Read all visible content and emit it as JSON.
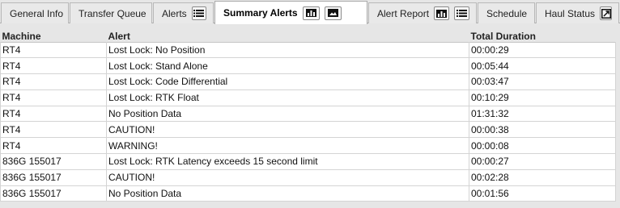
{
  "tabs": [
    {
      "label": "General Info"
    },
    {
      "label": "Transfer Queue"
    },
    {
      "label": "Alerts"
    },
    {
      "label": "Summary Alerts"
    },
    {
      "label": "Alert Report"
    },
    {
      "label": "Schedule"
    },
    {
      "label": "Haul Status"
    }
  ],
  "active_tab": "Summary Alerts",
  "table": {
    "headers": [
      "Machine",
      "Alert",
      "Total Duration"
    ],
    "rows": [
      [
        "RT4",
        "Lost Lock: No Position",
        "00:00:29"
      ],
      [
        "RT4",
        "Lost Lock: Stand Alone",
        "00:05:44"
      ],
      [
        "RT4",
        "Lost Lock: Code Differential",
        "00:03:47"
      ],
      [
        "RT4",
        "Lost Lock: RTK Float",
        "00:10:29"
      ],
      [
        "RT4",
        "No Position Data",
        "01:31:32"
      ],
      [
        "RT4",
        "CAUTION!",
        "00:00:38"
      ],
      [
        "RT4",
        "WARNING!",
        "00:00:08"
      ],
      [
        "836G 155017",
        "Lost Lock: RTK Latency exceeds 15 second limit",
        "00:00:27"
      ],
      [
        "836G 155017",
        "CAUTION!",
        "00:02:28"
      ],
      [
        "836G 155017",
        "No Position Data",
        "00:01:56"
      ]
    ]
  },
  "icons": {
    "alerts_button": "list-icon",
    "summary_chart_button": "bar-chart-icon",
    "summary_image_button": "image-icon",
    "report_chart_button": "bar-chart-icon",
    "report_list_button": "list-icon",
    "haul_status_button": "popout-icon"
  }
}
